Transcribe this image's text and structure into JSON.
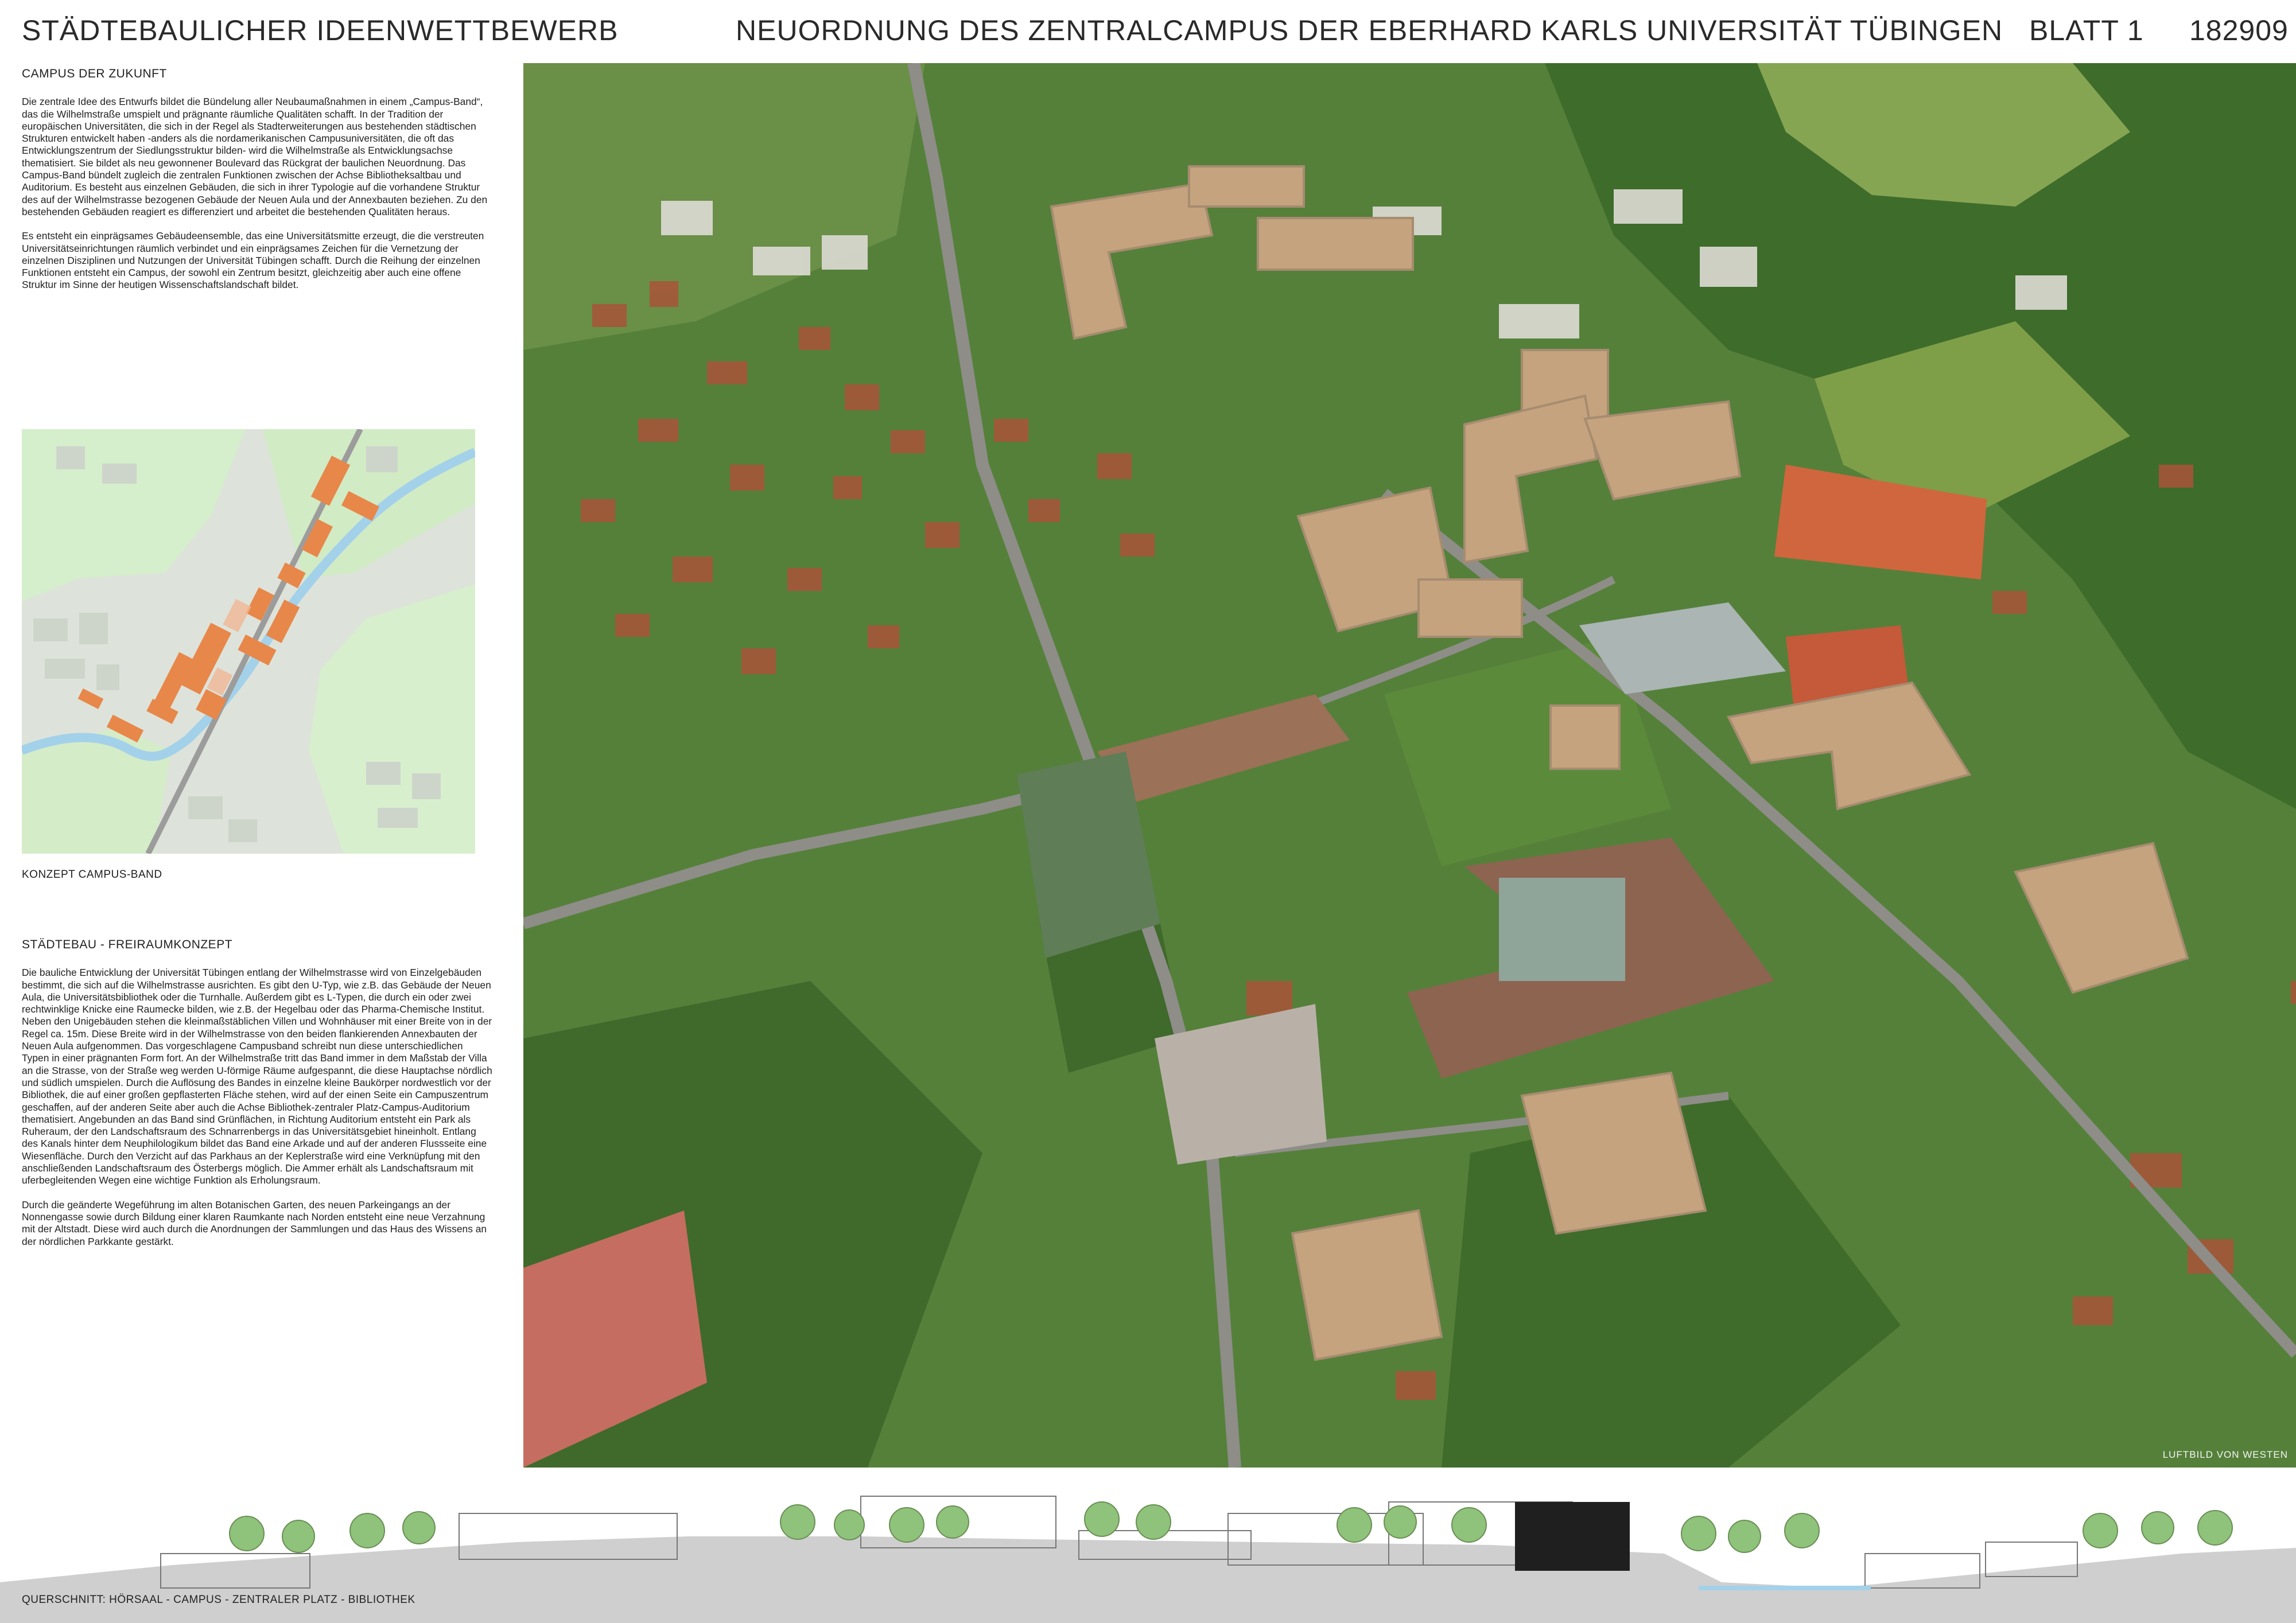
{
  "header": {
    "left_title": "STÄDTEBAULICHER IDEENWETTBEWERB",
    "center_title": "NEUORDNUNG DES ZENTRALCAMPUS DER EBERHARD KARLS UNIVERSITÄT TÜBINGEN",
    "sheet": "BLATT 1",
    "number": "182909"
  },
  "intro": {
    "heading": "CAMPUS DER ZUKUNFT",
    "paragraph1": "Die zentrale Idee des Entwurfs bildet die Bündelung aller Neubaumaßnahmen in einem „Campus-Band“, das die Wilhelmstraße umspielt und prägnante räumliche Qualitäten schafft. In der Tradition der europäischen Universitäten, die sich in der Regel als Stadterweiterungen aus bestehenden städtischen Strukturen entwickelt haben -anders als die nordamerikanischen Campusuniversitäten, die oft das Entwicklungszentrum der Siedlungsstruktur bilden- wird die Wilhelmstraße als Entwicklungsachse thematisiert. Sie bildet als neu gewonnener Boulevard das Rückgrat der baulichen Neuordnung. Das Campus-Band bündelt zugleich die zentralen Funktionen zwischen der Achse Bibliotheksaltbau und Auditorium. Es besteht aus einzelnen Gebäuden, die sich in ihrer Typologie auf die vorhandene Struktur des auf der Wilhelmstrasse bezogenen Gebäude der Neuen Aula und der Annexbauten beziehen. Zu den bestehenden Gebäuden reagiert es differenziert und arbeitet die bestehenden Qualitäten heraus.",
    "paragraph2": "Es entsteht ein einprägsames Gebäudeensemble, das eine Universitätsmitte erzeugt, die die verstreuten Universitätseinrichtungen räumlich verbindet und ein einprägsames Zeichen für die Vernetzung der einzelnen Disziplinen und Nutzungen der Universität Tübingen schafft. Durch die Reihung der einzelnen Funktionen entsteht ein Campus, der sowohl ein Zentrum besitzt, gleichzeitig aber auch eine offene Struktur im Sinne der heutigen Wissenschaftslandschaft bildet."
  },
  "concept": {
    "caption": "KONZEPT CAMPUS-BAND",
    "colors": {
      "background": "#dfe6dc",
      "green": "#d3edc2",
      "river": "#a8d4ec",
      "buildings": "#e8874a",
      "road": "#9a9a9a"
    }
  },
  "town": {
    "heading": "STÄDTEBAU - FREIRAUMKONZEPT",
    "paragraph1": "Die bauliche Entwicklung der Universität Tübingen entlang der Wilhelmstrasse wird von Einzelgebäuden bestimmt, die sich auf die Wilhelmstrasse ausrichten. Es gibt den U-Typ, wie z.B. das Gebäude der Neuen Aula, die Universitätsbibliothek oder die Turnhalle. Außerdem gibt es L-Typen, die durch ein oder zwei rechtwinklige Knicke eine Raumecke bilden, wie z.B. der Hegelbau oder das Pharma-Chemische Institut. Neben den Unigebäuden stehen die kleinmaßstäblichen Villen und Wohnhäuser mit einer Breite von in der Regel ca. 15m. Diese Breite wird in der Wilhelmstrasse von den beiden flankierenden Annexbauten der Neuen Aula aufgenommen. Das vorgeschlagene Campusband schreibt nun diese unterschiedlichen Typen in einer prägnanten Form fort. An der Wilhelmstraße tritt das Band immer in dem Maßstab der Villa an die Strasse, von der Straße weg werden U-förmige Räume aufgespannt, die diese Hauptachse nördlich und südlich umspielen. Durch die Auflösung des Bandes in einzelne kleine Baukörper nordwestlich vor der Bibliothek, die auf einer großen gepflasterten Fläche stehen, wird auf der einen Seite ein Campuszentrum geschaffen, auf der anderen Seite aber auch die Achse Bibliothek-zentraler Platz-Campus-Auditorium thematisiert. Angebunden an das Band sind Grünflächen, in Richtung Auditorium entsteht ein Park als Ruheraum, der den Landschaftsraum des Schnarrenbergs in das Universitätsgebiet hineinholt. Entlang des Kanals hinter dem Neuphilologikum bildet das Band eine Arkade und auf der anderen Flussseite eine Wiesenfläche. Durch den Verzicht auf das Parkhaus an der Keplerstraße wird eine Verknüpfung mit den anschließenden Landschaftsraum des Österbergs möglich. Die Ammer erhält als Landschaftsraum mit uferbegleitenden Wegen eine wichtige Funktion als Erholungsraum.",
    "paragraph2": "Durch die geänderte Wegeführung im alten Botanischen Garten, des neuen Parkeingangs an der Nonnengasse sowie durch Bildung einer klaren Raumkante nach Norden entsteht eine neue Verzahnung mit der Altstadt. Diese wird auch durch die Anordnungen der Sammlungen und das Haus des Wissens an der nördlichen Parkkante gestärkt."
  },
  "aerial": {
    "credit": "LUFTBILD VON WESTEN",
    "colors": {
      "forest": "#3f6e2e",
      "meadow": "#7fa24e",
      "street": "#8c8c86",
      "roof": "#b5563a",
      "proposed": "#c2a27d"
    }
  },
  "section": {
    "caption": "QUERSCHNITT:  HÖRSAAL - CAMPUS - ZENTRALER PLATZ - BIBLIOTHEK",
    "colors": {
      "ground": "#cfcfcf",
      "tree": "#8fc27a",
      "line": "#777777"
    }
  }
}
